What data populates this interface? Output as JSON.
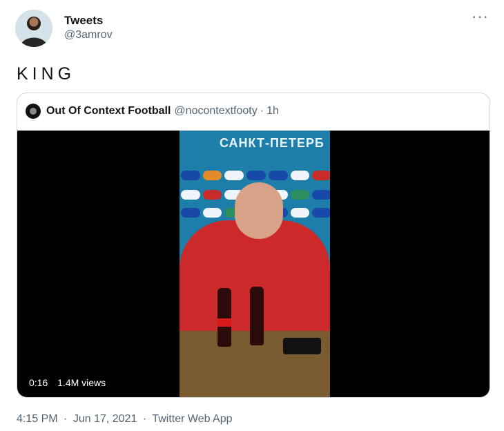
{
  "header": {
    "name": "Tweets",
    "handle": "@3amrov",
    "more_icon": "more-horizontal-icon"
  },
  "tweet": {
    "text": "KING"
  },
  "quote": {
    "name": "Out Of Context Football",
    "handle": "@nocontextfooty",
    "separator": "·",
    "time": "1h",
    "backdrop_text": "САНКТ-ПЕТЕРБ",
    "video": {
      "elapsed": "0:16",
      "views": "1.4M views"
    }
  },
  "footer": {
    "time": "4:15 PM",
    "date": "Jun 17, 2021",
    "separator": "·",
    "source": "Twitter Web App"
  }
}
